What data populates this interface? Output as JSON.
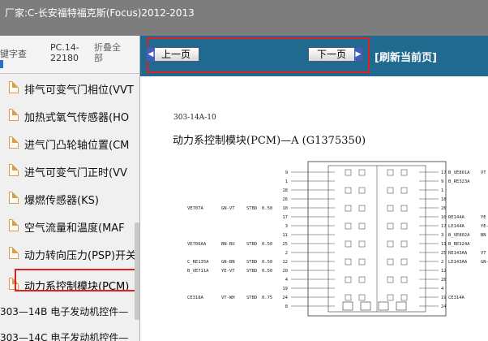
{
  "window": {
    "title": "厂家:C-长安福特福克斯(Focus)2012-2013"
  },
  "tabs": [
    {
      "label": "键字查"
    },
    {
      "label": "PC.14-22180"
    },
    {
      "label": "折叠全部"
    }
  ],
  "tree": {
    "items": [
      {
        "label": "排气可变气门相位(VVT"
      },
      {
        "label": "加热式氧气传感器(HO"
      },
      {
        "label": "进气门凸轮轴位置(CM"
      },
      {
        "label": "进气可变气门正时(VV"
      },
      {
        "label": "爆燃传感器(KS)"
      },
      {
        "label": "空气流量和温度(MAF"
      },
      {
        "label": "动力转向压力(PSP)开关"
      },
      {
        "label": "动力系控制模块(PCM)"
      }
    ],
    "groups": [
      {
        "label": "303—14B 电子发动机控件—"
      },
      {
        "label": "303—14C 电子发动机控件—"
      }
    ]
  },
  "nav": {
    "prev_label": "上一页",
    "next_label": "下一页",
    "refresh_label": "[刷新当前页]"
  },
  "document": {
    "ref": "303-14A-10",
    "title": "动力系控制模块(PCM)—A (G1375350)"
  },
  "diagram": {
    "left_pins": [
      "9",
      "1",
      "18",
      "26",
      "10",
      "17",
      "3",
      "11",
      "25",
      "2",
      "12",
      "20",
      "4",
      "19",
      "24",
      "8"
    ],
    "right_pins": [
      "17",
      "9",
      "1",
      "18",
      "26",
      "10",
      "17",
      "3",
      "11",
      "25",
      "2",
      "12",
      "20",
      "4",
      "19",
      "24",
      "8"
    ],
    "right_signals": [
      "B_VE801A",
      "B_RE323A",
      "",
      "",
      "",
      "RE144A",
      "LE144A",
      "B_VE802A",
      "B_RE324A",
      "RE143AA",
      "LE143AA",
      "",
      "",
      "",
      "CE314A",
      ""
    ],
    "right_colors": [
      "VT",
      "",
      "",
      "",
      "",
      "YE",
      "YE-VT",
      "BN",
      "",
      "VT",
      "GN-",
      "",
      "",
      "",
      "",
      ""
    ],
    "left_signals": [
      {
        "name": "VE707A",
        "color": "GN-VT",
        "size": "STBD",
        "gauge": "0.50"
      },
      {
        "name": "VE706AA",
        "color": "BN-BU",
        "size": "STBD",
        "gauge": "0.50"
      },
      {
        "name": "C_RE135A",
        "color": "GN-BN",
        "size": "STBD",
        "gauge": "0.50"
      },
      {
        "name": "B_VE711A",
        "color": "YE-VT",
        "size": "STBD",
        "gauge": "0.50"
      },
      {
        "name": "CE318A",
        "color": "VT-WH",
        "size": "STBD",
        "gauge": "0.75"
      }
    ]
  }
}
